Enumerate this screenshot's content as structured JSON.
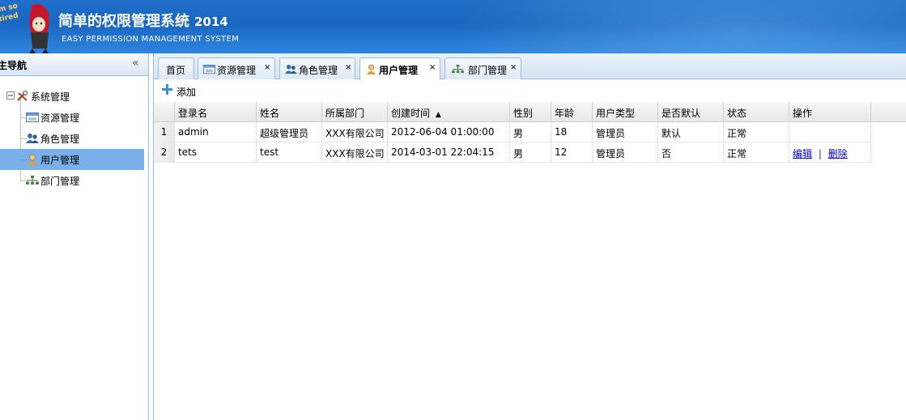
{
  "header": {
    "title": "简单的权限管理系统",
    "year": "2014",
    "subtitle": "EASY PERMISSION MANAGEMENT SYSTEM"
  },
  "sidebar": {
    "title": "主导航",
    "collapse_icon": "«",
    "tree": {
      "root": "系统管理",
      "items": [
        "资源管理",
        "角色管理",
        "用户管理",
        "部门管理"
      ],
      "selected": "用户管理"
    }
  },
  "tabs": [
    {
      "label": "首页",
      "closable": false
    },
    {
      "label": "资源管理",
      "closable": true
    },
    {
      "label": "角色管理",
      "closable": true
    },
    {
      "label": "用户管理",
      "closable": true,
      "active": true
    },
    {
      "label": "部门管理",
      "closable": true
    }
  ],
  "tab_close": "×",
  "toolbar": {
    "add_label": "添加"
  },
  "grid": {
    "columns": [
      "登录名",
      "姓名",
      "所属部门",
      "创建时间",
      "性别",
      "年龄",
      "用户类型",
      "是否默认",
      "状态",
      "操作"
    ],
    "sort_indicator": "▲",
    "rows": [
      {
        "num": "1",
        "login": "admin",
        "name": "超级管理员",
        "dept": "XXX有限公司",
        "created": "2012-06-04 01:00:00",
        "gender": "男",
        "age": "18",
        "type": "管理员",
        "default": "默认",
        "status": "正常",
        "edit": "",
        "sep": "",
        "del": ""
      },
      {
        "num": "2",
        "login": "tets",
        "name": "test",
        "dept": "XXX有限公司",
        "created": "2014-03-01 22:04:15",
        "gender": "男",
        "age": "12",
        "type": "管理员",
        "default": "否",
        "status": "正常",
        "edit": "编辑",
        "sep": "|",
        "del": "删除"
      }
    ]
  },
  "colors": {
    "header": "#1a66c0",
    "selected": "#7ab0ea",
    "border": "#99bbe8",
    "link": "#0000cc"
  }
}
